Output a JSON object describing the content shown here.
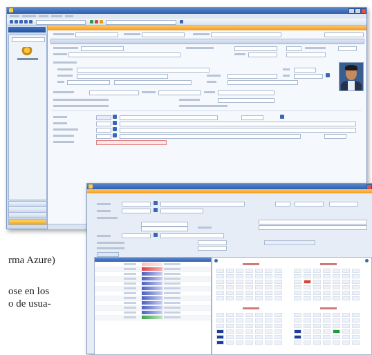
{
  "page": {
    "text_lines": [
      "rma Azure)",
      "ose en los",
      "o de usua-"
    ]
  },
  "main_window": {
    "menu": [],
    "sidebar_items": []
  },
  "colors": {
    "title_blue": "#2e5fae",
    "accent_orange": "#f29a1a",
    "panel_blue": "#e9eef6",
    "calendar_red": "#e0402a",
    "calendar_green": "#1f9a3c",
    "calendar_navy": "#1f3f9a"
  }
}
